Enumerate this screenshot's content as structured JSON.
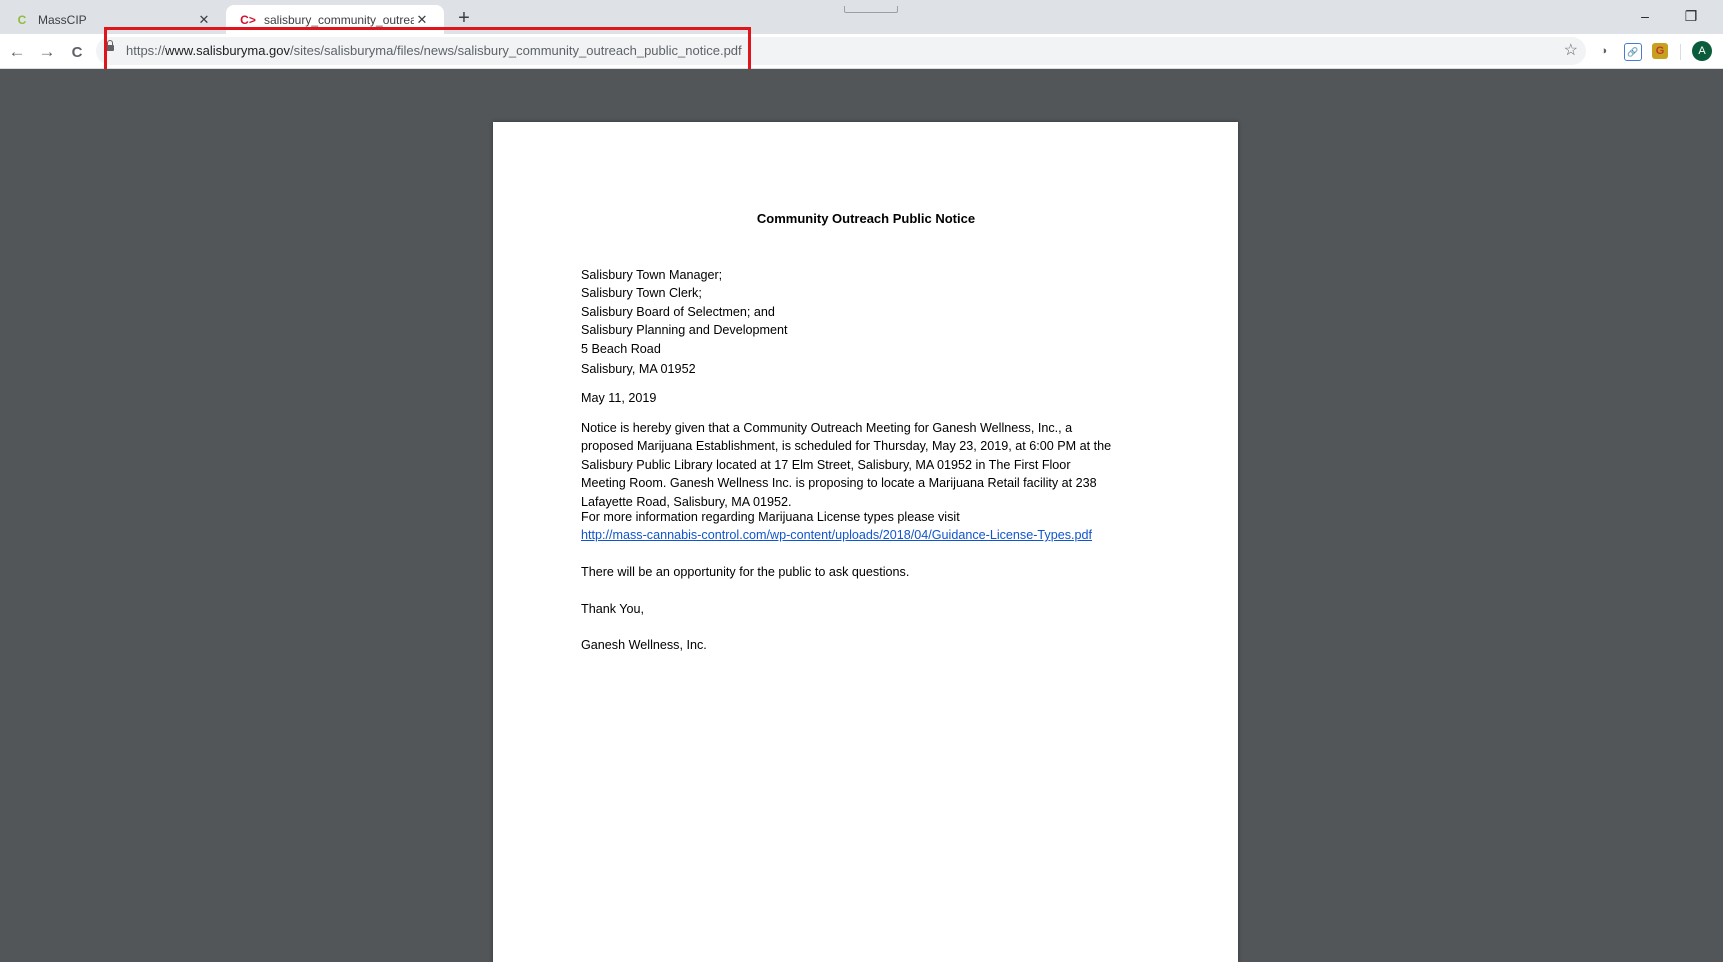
{
  "tabs": [
    {
      "title": "MassCIP",
      "favicon": "C",
      "active": false
    },
    {
      "title": "salisbury_community_outreach_p",
      "favicon": "C>",
      "active": true
    }
  ],
  "window": {
    "minimize": "–",
    "restore": "❐"
  },
  "nav": {
    "back": "←",
    "forward": "→",
    "reload": "C"
  },
  "address_bar": {
    "url_scheme": "https://",
    "url_host": "www.salisburyma.gov",
    "url_path": "/sites/salisburyma/files/news/salisbury_community_outreach_public_notice.pdf",
    "star": "☆"
  },
  "toolbar": {
    "ext1": "◑",
    "ext2": "🔗",
    "ext3": "G",
    "profile_initial": "A"
  },
  "colors": {
    "highlight": "#e0151b",
    "viewer_bg": "#525659",
    "link": "#1155cc",
    "avatar": "#0b5c3a"
  },
  "document": {
    "title": "Community Outreach Public Notice",
    "address_lines": [
      "Salisbury Town Manager;",
      "Salisbury Town Clerk;",
      "Salisbury Board of Selectmen; and",
      "Salisbury Planning and Development",
      "5 Beach Road",
      "Salisbury, MA 01952"
    ],
    "date": "May 11, 2019",
    "notice_lines": [
      "Notice is hereby given that a Community Outreach Meeting for Ganesh Wellness, Inc., a",
      "proposed Marijuana Establishment, is scheduled for Thursday, May 23, 2019, at 6:00 PM at the",
      "Salisbury Public Library located at 17 Elm Street, Salisbury, MA 01952 in The First Floor",
      "Meeting Room. Ganesh Wellness Inc. is proposing to locate a Marijuana Retail facility at 238",
      "Lafayette Road, Salisbury, MA 01952."
    ],
    "info_text": "For more information regarding Marijuana License types please visit",
    "info_link": "http://mass-cannabis-control.com/wp-content/uploads/2018/04/Guidance-License-Types.pdf",
    "questions": "There will be an opportunity for the public to ask questions.",
    "closing": "Thank You,",
    "signature": "Ganesh Wellness, Inc."
  }
}
